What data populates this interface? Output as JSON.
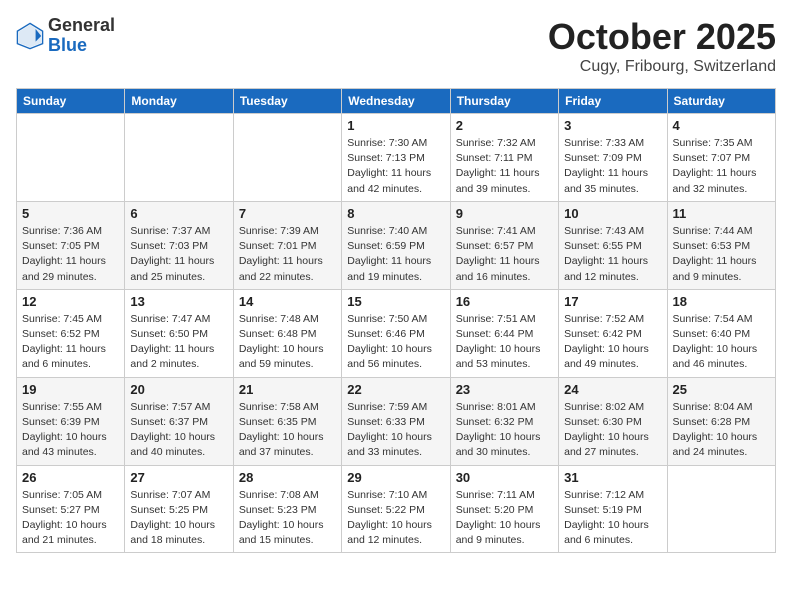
{
  "logo": {
    "general": "General",
    "blue": "Blue"
  },
  "header": {
    "month": "October 2025",
    "location": "Cugy, Fribourg, Switzerland"
  },
  "weekdays": [
    "Sunday",
    "Monday",
    "Tuesday",
    "Wednesday",
    "Thursday",
    "Friday",
    "Saturday"
  ],
  "weeks": [
    [
      {
        "day": "",
        "info": ""
      },
      {
        "day": "",
        "info": ""
      },
      {
        "day": "",
        "info": ""
      },
      {
        "day": "1",
        "sunrise": "7:30 AM",
        "sunset": "7:13 PM",
        "daylight": "11 hours and 42 minutes."
      },
      {
        "day": "2",
        "sunrise": "7:32 AM",
        "sunset": "7:11 PM",
        "daylight": "11 hours and 39 minutes."
      },
      {
        "day": "3",
        "sunrise": "7:33 AM",
        "sunset": "7:09 PM",
        "daylight": "11 hours and 35 minutes."
      },
      {
        "day": "4",
        "sunrise": "7:35 AM",
        "sunset": "7:07 PM",
        "daylight": "11 hours and 32 minutes."
      }
    ],
    [
      {
        "day": "5",
        "sunrise": "7:36 AM",
        "sunset": "7:05 PM",
        "daylight": "11 hours and 29 minutes."
      },
      {
        "day": "6",
        "sunrise": "7:37 AM",
        "sunset": "7:03 PM",
        "daylight": "11 hours and 25 minutes."
      },
      {
        "day": "7",
        "sunrise": "7:39 AM",
        "sunset": "7:01 PM",
        "daylight": "11 hours and 22 minutes."
      },
      {
        "day": "8",
        "sunrise": "7:40 AM",
        "sunset": "6:59 PM",
        "daylight": "11 hours and 19 minutes."
      },
      {
        "day": "9",
        "sunrise": "7:41 AM",
        "sunset": "6:57 PM",
        "daylight": "11 hours and 16 minutes."
      },
      {
        "day": "10",
        "sunrise": "7:43 AM",
        "sunset": "6:55 PM",
        "daylight": "11 hours and 12 minutes."
      },
      {
        "day": "11",
        "sunrise": "7:44 AM",
        "sunset": "6:53 PM",
        "daylight": "11 hours and 9 minutes."
      }
    ],
    [
      {
        "day": "12",
        "sunrise": "7:45 AM",
        "sunset": "6:52 PM",
        "daylight": "11 hours and 6 minutes."
      },
      {
        "day": "13",
        "sunrise": "7:47 AM",
        "sunset": "6:50 PM",
        "daylight": "11 hours and 2 minutes."
      },
      {
        "day": "14",
        "sunrise": "7:48 AM",
        "sunset": "6:48 PM",
        "daylight": "10 hours and 59 minutes."
      },
      {
        "day": "15",
        "sunrise": "7:50 AM",
        "sunset": "6:46 PM",
        "daylight": "10 hours and 56 minutes."
      },
      {
        "day": "16",
        "sunrise": "7:51 AM",
        "sunset": "6:44 PM",
        "daylight": "10 hours and 53 minutes."
      },
      {
        "day": "17",
        "sunrise": "7:52 AM",
        "sunset": "6:42 PM",
        "daylight": "10 hours and 49 minutes."
      },
      {
        "day": "18",
        "sunrise": "7:54 AM",
        "sunset": "6:40 PM",
        "daylight": "10 hours and 46 minutes."
      }
    ],
    [
      {
        "day": "19",
        "sunrise": "7:55 AM",
        "sunset": "6:39 PM",
        "daylight": "10 hours and 43 minutes."
      },
      {
        "day": "20",
        "sunrise": "7:57 AM",
        "sunset": "6:37 PM",
        "daylight": "10 hours and 40 minutes."
      },
      {
        "day": "21",
        "sunrise": "7:58 AM",
        "sunset": "6:35 PM",
        "daylight": "10 hours and 37 minutes."
      },
      {
        "day": "22",
        "sunrise": "7:59 AM",
        "sunset": "6:33 PM",
        "daylight": "10 hours and 33 minutes."
      },
      {
        "day": "23",
        "sunrise": "8:01 AM",
        "sunset": "6:32 PM",
        "daylight": "10 hours and 30 minutes."
      },
      {
        "day": "24",
        "sunrise": "8:02 AM",
        "sunset": "6:30 PM",
        "daylight": "10 hours and 27 minutes."
      },
      {
        "day": "25",
        "sunrise": "8:04 AM",
        "sunset": "6:28 PM",
        "daylight": "10 hours and 24 minutes."
      }
    ],
    [
      {
        "day": "26",
        "sunrise": "7:05 AM",
        "sunset": "5:27 PM",
        "daylight": "10 hours and 21 minutes."
      },
      {
        "day": "27",
        "sunrise": "7:07 AM",
        "sunset": "5:25 PM",
        "daylight": "10 hours and 18 minutes."
      },
      {
        "day": "28",
        "sunrise": "7:08 AM",
        "sunset": "5:23 PM",
        "daylight": "10 hours and 15 minutes."
      },
      {
        "day": "29",
        "sunrise": "7:10 AM",
        "sunset": "5:22 PM",
        "daylight": "10 hours and 12 minutes."
      },
      {
        "day": "30",
        "sunrise": "7:11 AM",
        "sunset": "5:20 PM",
        "daylight": "10 hours and 9 minutes."
      },
      {
        "day": "31",
        "sunrise": "7:12 AM",
        "sunset": "5:19 PM",
        "daylight": "10 hours and 6 minutes."
      },
      {
        "day": "",
        "info": ""
      }
    ]
  ]
}
